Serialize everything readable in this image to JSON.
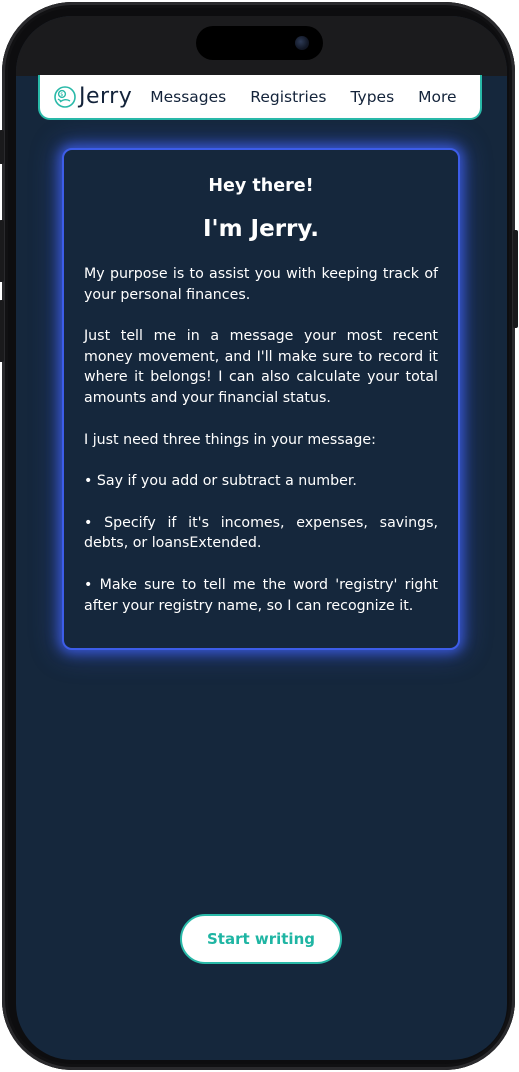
{
  "app": {
    "brand_name": "Jerry",
    "logo_icon": "piggy-coin-icon"
  },
  "nav": {
    "items": [
      {
        "label": "Messages"
      },
      {
        "label": "Registries"
      },
      {
        "label": "Types"
      },
      {
        "label": "More"
      }
    ]
  },
  "intro": {
    "greeting": "Hey there!",
    "title": "I'm Jerry.",
    "paragraphs": [
      "My purpose is to assist you with keeping track of your personal finances.",
      "Just tell me in a message your most recent money movement, and I'll make sure to record it where it belongs! I can also calculate your total amounts and your financial status.",
      "I just need three things in your message:",
      "• Say if you add or subtract a number.",
      "• Specify if it's incomes, expenses, savings, debts, or loansExtended.",
      "• Make sure to tell me the word 'registry' right after your registry name, so I can recognize it."
    ]
  },
  "cta": {
    "label": "Start writing"
  },
  "colors": {
    "background": "#15273c",
    "accent_teal": "#29b9a8",
    "glow_blue": "#3d5de8",
    "text_dark": "#13233a"
  }
}
